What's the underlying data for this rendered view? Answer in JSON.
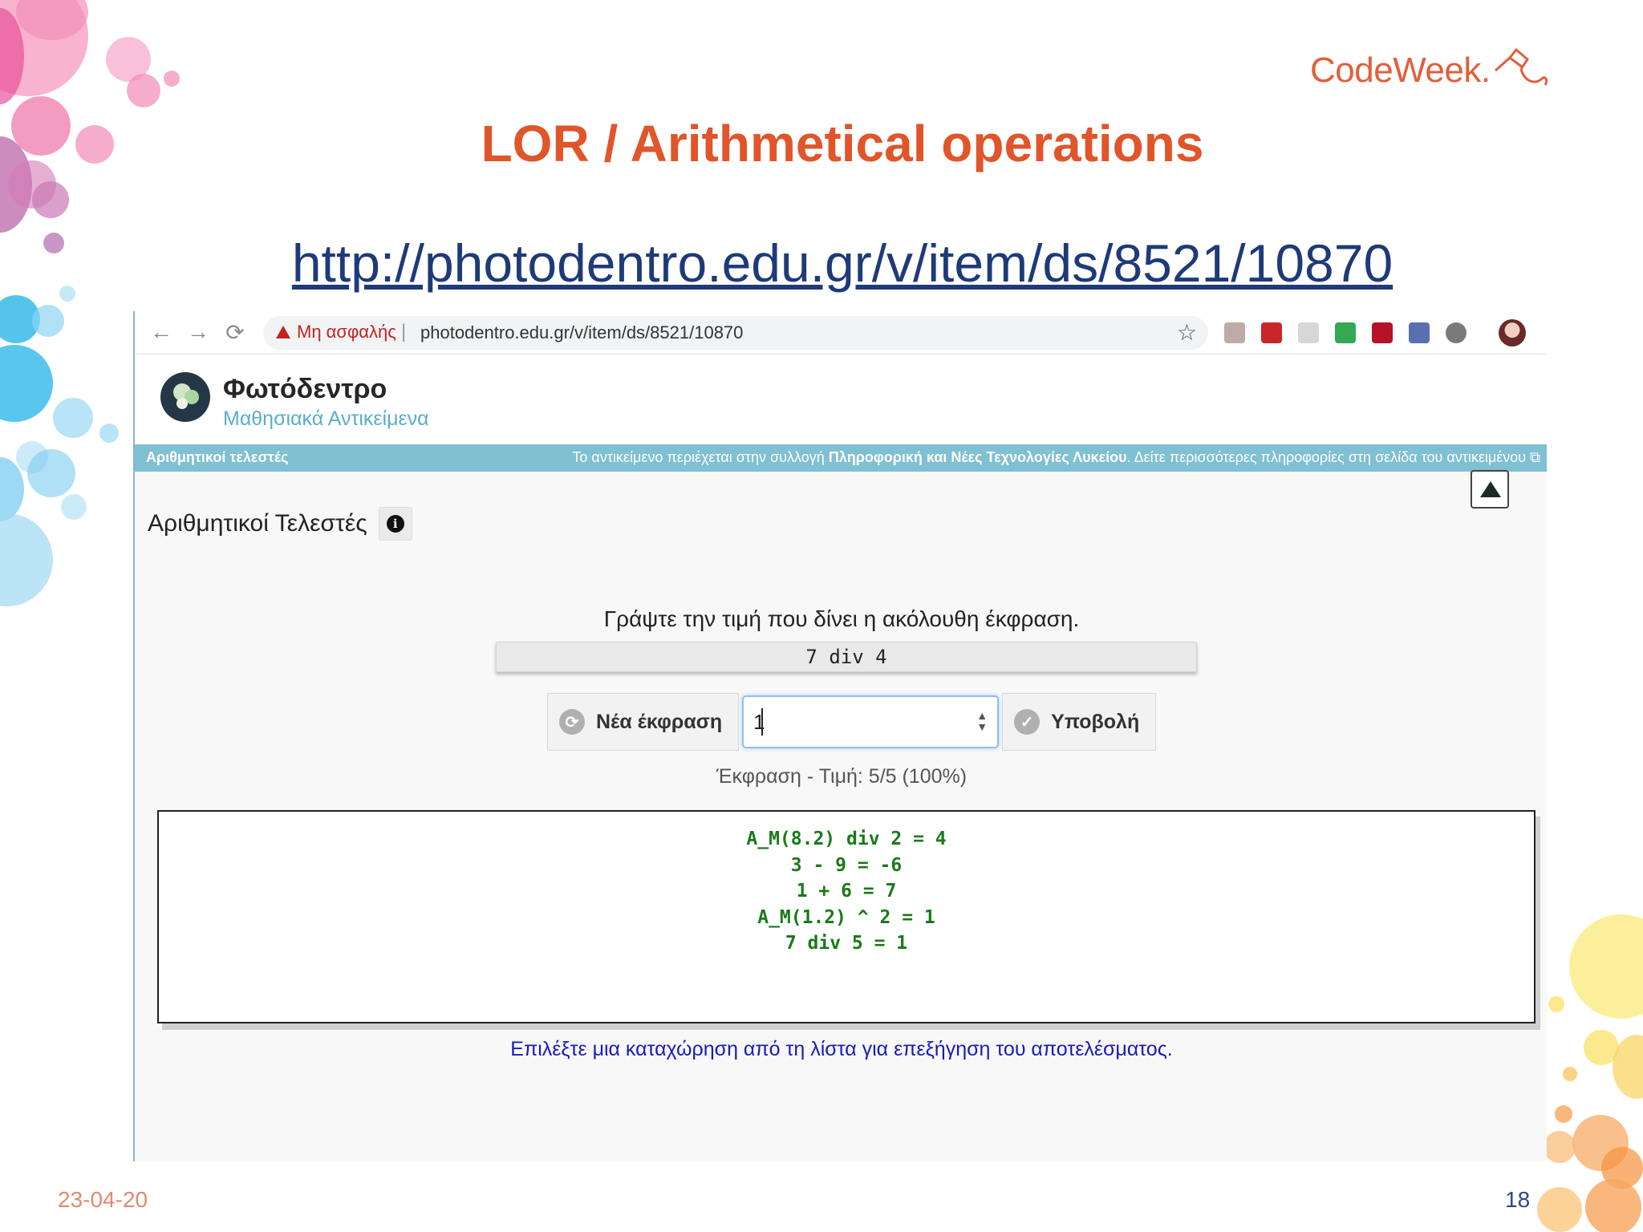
{
  "slide": {
    "logo_text": "CodeWeek.",
    "title": "LOR / Arithmetical operations",
    "link": "http://photodentro.edu.gr/v/item/ds/8521/10870",
    "date": "23-04-20",
    "page_number": "18"
  },
  "browser": {
    "back_icon": "←",
    "forward_icon": "→",
    "reload_icon": "⟳",
    "security_label": "Μη ασφαλής",
    "separator": "|",
    "url": "photodentro.edu.gr/v/item/ds/8521/10870",
    "star_icon": "☆"
  },
  "site": {
    "name": "Φωτόδεντρο",
    "subtitle": "Μαθησιακά Αντικείμενα",
    "info_left": "Αριθμητικοί τελεστές",
    "info_right_prefix": "Το αντικείμενο περιέχεται στην συλλογή ",
    "info_right_collection": "Πληροφορική και Νέες Τεχνολογίες Λυκείου",
    "info_right_suffix": ". Δείτε περισσότερες πληροφορίες στη σελίδα του αντικειμένου"
  },
  "exercise": {
    "heading": "Αριθμητικοί Τελεστές",
    "info_icon": "i",
    "prompt": "Γράψτε την τιμή που δίνει η ακόλουθη έκφραση.",
    "expression": "7 div 4",
    "new_button": "Νέα έκφραση",
    "input_value": "1",
    "submit_button": "Υποβολή",
    "score": "Έκφραση - Τιμή: 5/5 (100%)",
    "results": [
      "A_M(8.2) div 2 = 4",
      "3 - 9 = -6",
      "1 + 6 = 7",
      "A_M(1.2) ^ 2 = 1",
      "7 div 5 = 1"
    ],
    "hint": "Επιλέξτε μια καταχώρηση από τη λίστα για επεξήγηση του αποτελέσματος."
  },
  "colors": {
    "title_orange": "#e0552a",
    "link_blue": "#1f3a78",
    "info_bar": "#7fc0d2",
    "result_green": "#1a7a1a",
    "hint_blue": "#1a1ab8"
  }
}
